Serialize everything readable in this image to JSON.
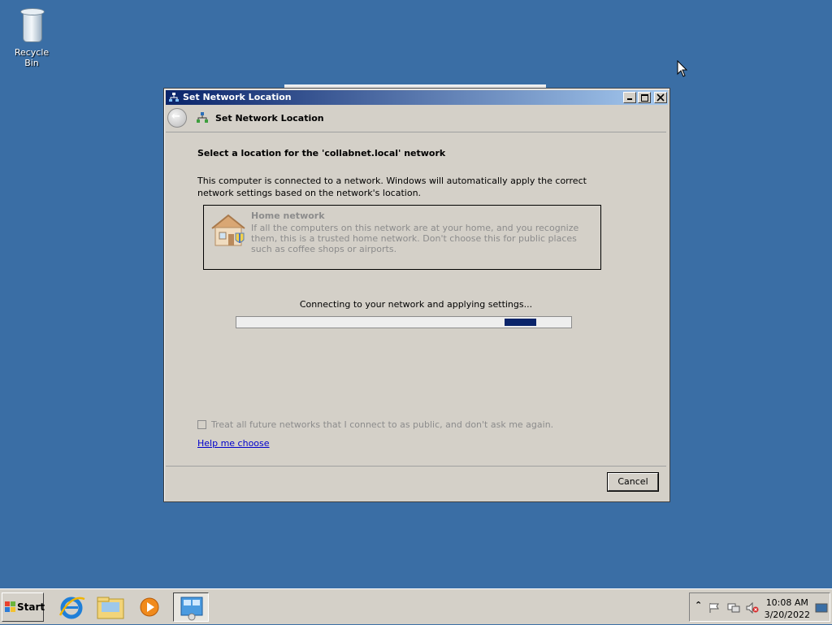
{
  "desktop": {
    "recycle_bin_label": "Recycle Bin"
  },
  "window": {
    "title": "Set Network Location",
    "nav_title": "Set Network Location"
  },
  "content": {
    "heading": "Select a location for the 'collabnet.local' network",
    "description": "This computer is connected to a network. Windows will automatically apply the correct network settings based on the network's location.",
    "option": {
      "title": "Home network",
      "description": "If all the computers on this network are at your home, and you recognize them, this is a trusted home network.  Don't choose this for public places such as coffee shops or airports."
    },
    "status_text": "Connecting to your network and applying settings...",
    "checkbox_label": "Treat all future networks that I connect to as public, and don't ask me again.",
    "checkbox_checked": false,
    "help_link": "Help me choose",
    "cancel_label": "Cancel"
  },
  "taskbar": {
    "start_label": "Start",
    "apps": [
      "internet-explorer",
      "windows-explorer",
      "media-player",
      "network-center"
    ],
    "clock_time": "10:08 AM",
    "clock_date": "3/20/2022"
  },
  "colors": {
    "desktop": "#3a6ea5",
    "title_gradient_start": "#0a246a",
    "title_gradient_end": "#a6caf0",
    "progress_chunk": "#0a246a"
  }
}
